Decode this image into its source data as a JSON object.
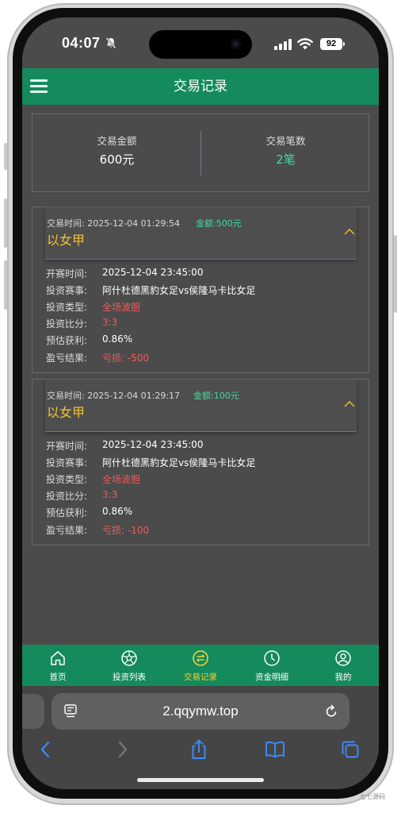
{
  "status_bar": {
    "time": "04:07",
    "battery": "92"
  },
  "header": {
    "title": "交易记录"
  },
  "summary": {
    "amount_label": "交易金额",
    "amount_value": "600元",
    "count_label": "交易笔数",
    "count_value": "2笔"
  },
  "records": [
    {
      "time_label": "交易时间: 2025-12-04 01:29:54",
      "amount": "金额:500元",
      "title": "以女甲",
      "rows": [
        {
          "key": "开赛时间:",
          "value": "2025-12-04 23:45:00"
        },
        {
          "key": "投资赛事:",
          "value": "阿什杜德黑豹女足vs侯隆马卡比女足"
        },
        {
          "key": "投资类型:",
          "value": "全场波胆"
        },
        {
          "key": "投资比分:",
          "value": "3:3"
        },
        {
          "key": "预估获利:",
          "value": "0.86%"
        },
        {
          "key": "盈亏结果:",
          "value": "亏损: -500"
        }
      ]
    },
    {
      "time_label": "交易时间: 2025-12-04 01:29:17",
      "amount": "金额:100元",
      "title": "以女甲",
      "rows": [
        {
          "key": "开赛时间:",
          "value": "2025-12-04 23:45:00"
        },
        {
          "key": "投资赛事:",
          "value": "阿什杜德黑豹女足vs侯隆马卡比女足"
        },
        {
          "key": "投资类型:",
          "value": "全场波胆"
        },
        {
          "key": "投资比分:",
          "value": "3:3"
        },
        {
          "key": "预估获利:",
          "value": "0.86%"
        },
        {
          "key": "盈亏结果:",
          "value": "亏损: -100"
        }
      ]
    }
  ],
  "tabs": [
    {
      "label": "首页",
      "icon": "home-icon"
    },
    {
      "label": "投资列表",
      "icon": "soccer-ball-icon"
    },
    {
      "label": "交易记录",
      "icon": "exchange-icon",
      "active": true
    },
    {
      "label": "资金明细",
      "icon": "clock-icon"
    },
    {
      "label": "我的",
      "icon": "user-icon"
    }
  ],
  "browser": {
    "url": "2.qqymw.top"
  },
  "watermark": "七七源码",
  "colors": {
    "brand_green": "#158a5c",
    "accent_green": "#3fdca0",
    "gold": "#f6c234",
    "loss_red": "#ec5b5b",
    "background": "#4b4b4b"
  }
}
